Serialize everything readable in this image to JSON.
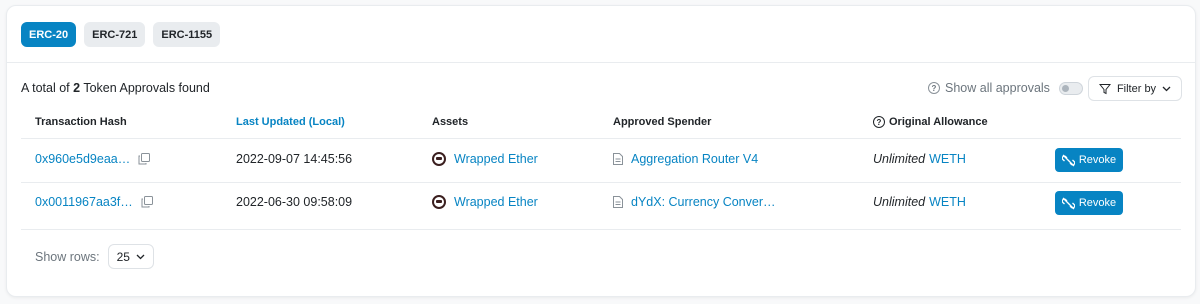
{
  "tabs": [
    {
      "label": "ERC-20",
      "active": true
    },
    {
      "label": "ERC-721",
      "active": false
    },
    {
      "label": "ERC-1155",
      "active": false
    }
  ],
  "summary": {
    "prefix": "A total of",
    "count": "2",
    "suffix": "Token Approvals found"
  },
  "show_all_label": "Show all approvals",
  "filter_label": "Filter by",
  "columns": {
    "tx_hash": "Transaction Hash",
    "last_updated": "Last Updated (Local)",
    "assets": "Assets",
    "spender": "Approved Spender",
    "allowance": "Original Allowance"
  },
  "rows": [
    {
      "tx_hash": "0x960e5d9eaa…",
      "updated": "2022-09-07 14:45:56",
      "asset": "Wrapped Ether",
      "spender": "Aggregation Router V4",
      "allowance_qualifier": "Unlimited",
      "allowance_token": "WETH",
      "action": "Revoke"
    },
    {
      "tx_hash": "0x0011967aa3f…",
      "updated": "2022-06-30 09:58:09",
      "asset": "Wrapped Ether",
      "spender": "dYdX: Currency Conver…",
      "allowance_qualifier": "Unlimited",
      "allowance_token": "WETH",
      "action": "Revoke"
    }
  ],
  "show_rows_label": "Show rows:",
  "rows_per_page": "25",
  "colors": {
    "accent": "#0784c3",
    "muted": "#6c757d"
  }
}
